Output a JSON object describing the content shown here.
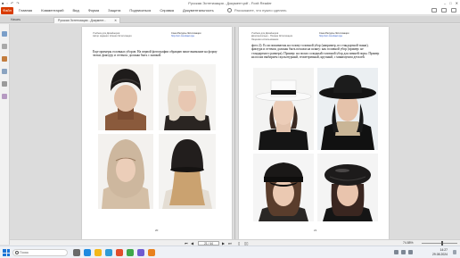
{
  "window": {
    "title": "Русская Эстетизация - Документ.pdf - Foxit Reader",
    "controls": [
      "–",
      "□",
      "✕"
    ]
  },
  "menu": {
    "file": "Файл",
    "items": [
      "Главная",
      "Комментарий",
      "Вид",
      "Форма",
      "Защита",
      "Подписаться",
      "Справка",
      "Документальность"
    ],
    "tell_me": "Расскажите, что нужно сделать"
  },
  "tabs": {
    "start": "Начать",
    "document": "Русская Эстетизация - Документ..."
  },
  "pages": {
    "left": {
      "header_left": [
        "Учебник для Дизайнеров",
        "Автор издания: Ксения Эстетизация"
      ],
      "header_right": [
        "Союз Ресурсы Эстетизации",
        "http://эст.com/вектора"
      ],
      "body": "Еще примеры головных уборов. На первой фотографии обращаю ваше внимание на форму челки, фактуру и оттенок: должны быть с шапкой.",
      "page_number": "20"
    },
    "right": {
      "header_left": [
        "Учебник для Дизайнеров",
        "Дополнительно - Полная Эстетизация",
        "Лицензия использования"
      ],
      "header_right": [
        "Союз Ресурсы Эстетизации",
        "http://эст.com/вектора"
      ],
      "body": "фото 2): Если пошиваешь на голову головной убор (например, из стандартной ткани), фактура и оттенок должны быть похожи на шляпу: как головной убор (пример: не стандартного размера). Пример: на полях солидный головной убор для зимней поры. Пример на полях выбираем скульптурный, геометричный, крупный, с минимумом деталей.",
      "page_number": "21"
    }
  },
  "navigation": {
    "page_field": "21 / 44",
    "zoom_percent": "74.88%"
  },
  "taskbar": {
    "search_placeholder": "Поиск",
    "time": "14:27",
    "date": "29.08.2024"
  },
  "colors": {
    "file_button": "#d83b01",
    "link": "#2b57c7",
    "start_button": "#1b74d6"
  }
}
